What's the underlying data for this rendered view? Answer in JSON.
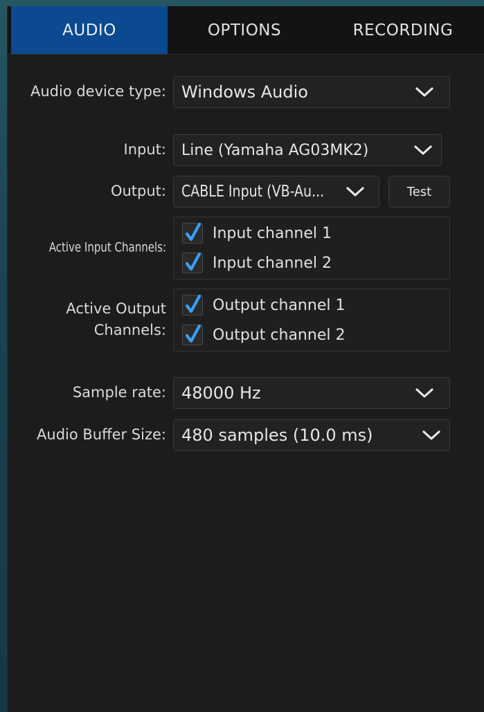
{
  "tabs": [
    {
      "label": "AUDIO",
      "active": true
    },
    {
      "label": "OPTIONS",
      "active": false
    },
    {
      "label": "RECORDING",
      "active": false
    }
  ],
  "audio_device_type": {
    "label": "Audio device type:",
    "value": "Windows Audio"
  },
  "input": {
    "label": "Input:",
    "value": "Line (Yamaha AG03MK2)"
  },
  "output": {
    "label": "Output:",
    "value": "CABLE Input (VB-Au...",
    "test_label": "Test"
  },
  "active_input_channels": {
    "label": "Active Input Channels:",
    "channels": [
      {
        "label": "Input channel 1",
        "checked": true
      },
      {
        "label": "Input channel 2",
        "checked": true
      }
    ]
  },
  "active_output_channels": {
    "label_line1": "Active Output",
    "label_line2": "Channels:",
    "channels": [
      {
        "label": "Output channel 1",
        "checked": true
      },
      {
        "label": "Output channel 2",
        "checked": true
      }
    ]
  },
  "sample_rate": {
    "label": "Sample rate:",
    "value": "48000 Hz"
  },
  "buffer_size": {
    "label": "Audio Buffer Size:",
    "value": "480 samples (10.0 ms)"
  },
  "icons": {
    "dropdown": "chevron-down-icon",
    "checkbox": "checkmark-icon"
  },
  "colors": {
    "accent_tab": "#0b4a90",
    "check": "#3aa0ff",
    "panel": "#1c1c1c"
  }
}
